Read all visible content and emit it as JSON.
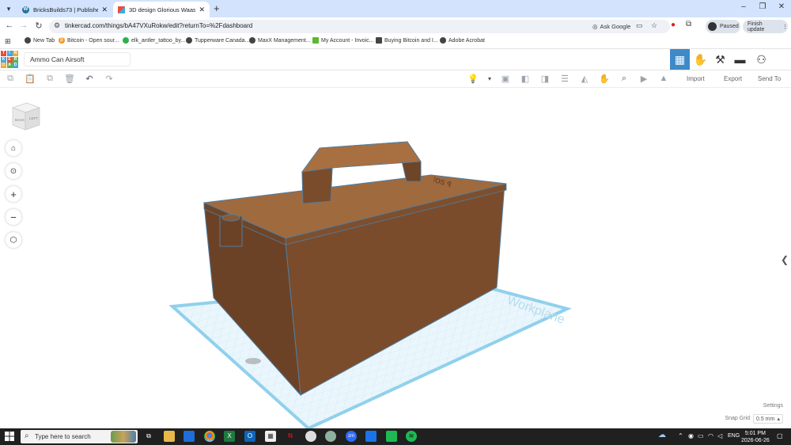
{
  "browser": {
    "tabs": [
      {
        "title": "BricksBuilds73 | Published - Ma",
        "icon": "wordpress-icon",
        "active": false
      },
      {
        "title": "3D design Glorious Waasa-Turi",
        "icon": "tinkercad-icon",
        "active": true
      }
    ],
    "url": "tinkercad.com/things/bA47VXuRokw/edit?returnTo=%2Fdashboard",
    "ask_google": "Ask Google",
    "profile_status": "Paused",
    "finish_update": "Finish update",
    "bookmarks": [
      {
        "label": "New Tab",
        "color": "#444444"
      },
      {
        "label": "Bitcoin - Open sour...",
        "color": "#f7931a"
      },
      {
        "label": "elk_antler_tattoo_by...",
        "color": "#2bb24c"
      },
      {
        "label": "Tupperware Canada...",
        "color": "#444444"
      },
      {
        "label": "MaxX Management...",
        "color": "#444444"
      },
      {
        "label": "My Account - Invoic...",
        "color": "#5cb82f"
      },
      {
        "label": "Buying Bitcoin and I...",
        "color": "#444444"
      },
      {
        "label": "Adobe Acrobat",
        "color": "#444444"
      }
    ]
  },
  "app": {
    "logo_letters": [
      "T",
      "I",
      "N",
      "K",
      "E",
      "R",
      "C",
      "A",
      "D"
    ],
    "logo_colors": [
      "#e84d3c",
      "#3fa9dd",
      "#f0a83a",
      "#3fa9dd",
      "#e84d3c",
      "#5bb548",
      "#f0a83a",
      "#5bb548",
      "#3fa9dd"
    ],
    "project_name": "Ammo Can Airsoft",
    "toolbar": {
      "import": "Import",
      "export": "Export",
      "send_to": "Send To"
    },
    "viewcube": {
      "face1": "BACK",
      "face2": "LEFT"
    },
    "workplane_label": "Workplane",
    "settings": "Settings",
    "snap_grid_label": "Snap Grid",
    "snap_grid_value": "0.5 mm",
    "model_color": "#87532f",
    "accent_color": "#3d8ac9"
  },
  "taskbar": {
    "search_placeholder": "Type here to search",
    "language": "ENG",
    "time": "5:01 PM",
    "date": "2026-06-26"
  }
}
